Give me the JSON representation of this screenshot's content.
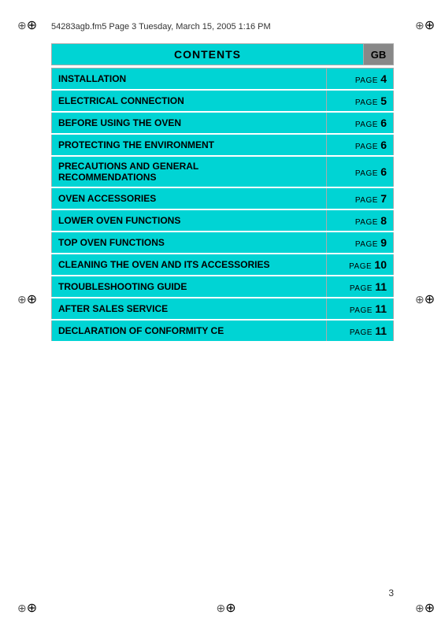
{
  "header": {
    "text": "54283agb.fm5  Page 3  Tuesday, March 15, 2005  1:16 PM"
  },
  "contents": {
    "title": "CONTENTS",
    "gb_label": "GB"
  },
  "toc": {
    "items": [
      {
        "label": "INSTALLATION",
        "page_word": "PAGE",
        "page_num": "4",
        "multiline": false
      },
      {
        "label": "ELECTRICAL CONNECTION",
        "page_word": "PAGE",
        "page_num": "5",
        "multiline": false
      },
      {
        "label": "BEFORE USING THE OVEN",
        "page_word": "PAGE",
        "page_num": "6",
        "multiline": false
      },
      {
        "label": "PROTECTING THE ENVIRONMENT",
        "page_word": "PAGE",
        "page_num": "6",
        "multiline": false
      },
      {
        "label": "PRECAUTIONS AND GENERAL\nRECOMMENDATIONS",
        "page_word": "PAGE",
        "page_num": "6",
        "multiline": true
      },
      {
        "label": "OVEN ACCESSORIES",
        "page_word": "PAGE",
        "page_num": "7",
        "multiline": false
      },
      {
        "label": "LOWER OVEN FUNCTIONS",
        "page_word": "PAGE",
        "page_num": "8",
        "multiline": false
      },
      {
        "label": "TOP OVEN FUNCTIONS",
        "page_word": "PAGE",
        "page_num": "9",
        "multiline": false
      },
      {
        "label": "CLEANING THE OVEN AND ITS ACCESSORIES",
        "page_word": "PAGE",
        "page_num": "10",
        "multiline": false
      },
      {
        "label": "TROUBLESHOOTING GUIDE",
        "page_word": "PAGE",
        "page_num": "11",
        "multiline": false
      },
      {
        "label": "AFTER SALES SERVICE",
        "page_word": "PAGE",
        "page_num": "11",
        "multiline": false
      },
      {
        "label": "DECLARATION OF CONFORMITY CE",
        "page_word": "PAGE",
        "page_num": "11",
        "multiline": false
      }
    ]
  },
  "footer": {
    "page_number": "3"
  }
}
